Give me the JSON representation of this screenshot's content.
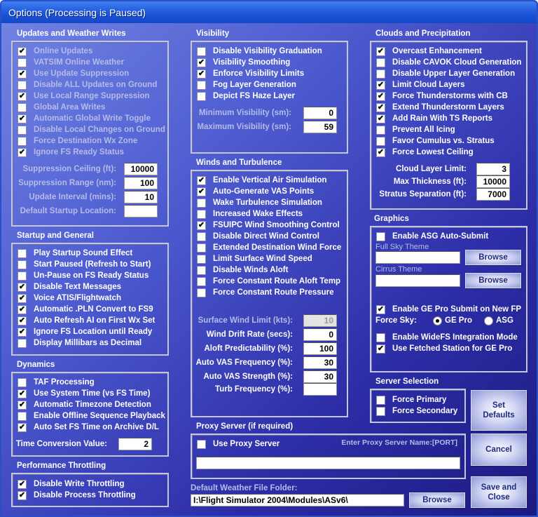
{
  "window": {
    "title": "Options (Processing is Paused)"
  },
  "groups": {
    "updates": {
      "title": "Updates and Weather Writes",
      "disabled": true,
      "items": [
        {
          "label": "Online Updates",
          "checked": true
        },
        {
          "label": "VATSIM Online Weather",
          "checked": false
        },
        {
          "label": "Use Update Suppression",
          "checked": true
        },
        {
          "label": "Disable ALL Updates on Ground",
          "checked": false
        },
        {
          "label": "Use Local Range Suppression",
          "checked": true
        },
        {
          "label": "Global Area Writes",
          "checked": false
        },
        {
          "label": "Automatic Global Write Toggle",
          "checked": true
        },
        {
          "label": "Disable Local Changes on Ground",
          "checked": false
        },
        {
          "label": "Force Destination Wx Zone",
          "checked": false
        },
        {
          "label": "Ignore FS Ready Status",
          "checked": true
        }
      ],
      "fields": [
        {
          "label": "Suppression Ceiling (ft):",
          "value": "10000",
          "disabled": true
        },
        {
          "label": "Suppression Range (nm):",
          "value": "100",
          "disabled": true
        },
        {
          "label": "Update Interval (mins):",
          "value": "10",
          "disabled": true
        },
        {
          "label": "Default Startup Location:",
          "value": "",
          "disabled": true
        }
      ]
    },
    "startup": {
      "title": "Startup and General",
      "items": [
        {
          "label": "Play Startup Sound Effect",
          "checked": false
        },
        {
          "label": "Start Paused (Refresh to Start)",
          "checked": false
        },
        {
          "label": "Un-Pause on FS Ready Status",
          "checked": false
        },
        {
          "label": "Disable Text Messages",
          "checked": true
        },
        {
          "label": "Voice ATIS/Flightwatch",
          "checked": true
        },
        {
          "label": "Automatic .PLN Convert to FS9",
          "checked": true
        },
        {
          "label": "Auto Refresh AI on First Wx Set",
          "checked": true
        },
        {
          "label": "Ignore FS Location until Ready",
          "checked": true
        },
        {
          "label": "Display Millibars as Decimal",
          "checked": false
        }
      ],
      "fields": []
    },
    "dynamics": {
      "title": "Dynamics",
      "items": [
        {
          "label": "TAF Processing",
          "checked": false
        },
        {
          "label": "Use System Time (vs FS Time)",
          "checked": true
        },
        {
          "label": "Automatic Timezone Detection",
          "checked": true
        },
        {
          "label": "Enable Offline Sequence Playback",
          "checked": false
        },
        {
          "label": "Auto Set FS Time on Archive D/L",
          "checked": true
        }
      ],
      "fields": [
        {
          "label": "Time Conversion Value:",
          "value": "2",
          "disabled": false
        }
      ]
    },
    "perf": {
      "title": "Performance Throttling",
      "items": [
        {
          "label": "Disable Write Throttling",
          "checked": true
        },
        {
          "label": "Disable Process Throttling",
          "checked": true
        }
      ],
      "fields": []
    },
    "visibility": {
      "title": "Visibility",
      "items": [
        {
          "label": "Disable Visibility Graduation",
          "checked": false
        },
        {
          "label": "Visibility Smoothing",
          "checked": true
        },
        {
          "label": "Enforce Visibility Limits",
          "checked": true
        },
        {
          "label": "Fog Layer Generation",
          "checked": false
        },
        {
          "label": "Depict FS Haze Layer",
          "checked": false
        }
      ],
      "fields": [
        {
          "label": "Minimum Visibility (sm):",
          "value": "0",
          "disabled": false,
          "labelDisabled": true
        },
        {
          "label": "Maximum Visibility (sm):",
          "value": "59",
          "disabled": false,
          "labelDisabled": true
        }
      ]
    },
    "winds": {
      "title": "Winds and Turbulence",
      "items": [
        {
          "label": "Enable Vertical Air Simulation",
          "checked": true
        },
        {
          "label": "Auto-Generate VAS Points",
          "checked": true
        },
        {
          "label": "Wake Turbulence Simulation",
          "checked": false
        },
        {
          "label": "Increased Wake Effects",
          "checked": false
        },
        {
          "label": "FSUIPC Wind Smoothing Control",
          "checked": true
        },
        {
          "label": "Disable Direct Wind Control",
          "checked": false
        },
        {
          "label": "Extended Destination Wind Force",
          "checked": false
        },
        {
          "label": "Limit Surface Wind Speed",
          "checked": false
        },
        {
          "label": "Disable Winds Aloft",
          "checked": false
        },
        {
          "label": "Force Constant Route Aloft Temp",
          "checked": false
        },
        {
          "label": "Force Constant Route Pressure",
          "checked": false
        }
      ],
      "fields": [
        {
          "label": "Surface Wind Limit (kts):",
          "value": "10",
          "disabled": true
        },
        {
          "label": "Wind Drift Rate (secs):",
          "value": "0",
          "disabled": false
        },
        {
          "label": "Aloft Predictability (%):",
          "value": "100",
          "disabled": false
        },
        {
          "label": "Auto VAS Frequency (%):",
          "value": "30",
          "disabled": false
        },
        {
          "label": "Auto VAS Strength (%):",
          "value": "30",
          "disabled": false
        },
        {
          "label": "Turb Frequency (%):",
          "value": "",
          "disabled": false
        }
      ]
    },
    "clouds": {
      "title": "Clouds and Precipitation",
      "items": [
        {
          "label": "Overcast Enhancement",
          "checked": true
        },
        {
          "label": "Disable CAVOK Cloud Generation",
          "checked": false
        },
        {
          "label": "Disable Upper Layer Generation",
          "checked": false
        },
        {
          "label": "Limit Cloud Layers",
          "checked": true
        },
        {
          "label": "Force Thunderstorms with CB",
          "checked": true
        },
        {
          "label": "Extend Thunderstorm Layers",
          "checked": true
        },
        {
          "label": "Add Rain With TS Reports",
          "checked": true
        },
        {
          "label": "Prevent All Icing",
          "checked": false
        },
        {
          "label": "Favor Cumulus vs. Stratus",
          "checked": false
        },
        {
          "label": "Force Lowest Ceiling",
          "checked": true
        }
      ],
      "fields": [
        {
          "label": "Cloud Layer Limit:",
          "value": "3",
          "disabled": false
        },
        {
          "label": "Max Thickness (ft):",
          "value": "10000",
          "disabled": false
        },
        {
          "label": "Stratus Separation (ft):",
          "value": "7000",
          "disabled": false
        }
      ]
    },
    "server": {
      "title": "Server Selection",
      "items": [
        {
          "label": "Force Primary",
          "checked": false
        },
        {
          "label": "Force Secondary",
          "checked": false
        }
      ],
      "fields": []
    }
  },
  "graphics": {
    "title": "Graphics",
    "asg_label": "Enable ASG Auto-Submit",
    "asg_checked": false,
    "full_sky_label": "Full Sky Theme",
    "full_sky_value": "",
    "cirrus_label": "Cirrus Theme",
    "cirrus_value": "",
    "browse": "Browse",
    "gepro_label": "Enable GE Pro Submit on New FP",
    "gepro_checked": true,
    "force_sky_label": "Force Sky:",
    "radio_gepro": "GE Pro",
    "radio_asg": "ASG",
    "widefs_label": "Enable WideFS Integration Mode",
    "widefs_checked": false,
    "fetched_label": "Use Fetched Station for GE Pro",
    "fetched_checked": true
  },
  "proxy": {
    "title": "Proxy Server (if required)",
    "use_label": "Use Proxy Server",
    "use_checked": false,
    "hint": "Enter Proxy Server Name:[PORT]",
    "value": ""
  },
  "folder": {
    "label": "Default Weather File Folder:",
    "value": "I:\\Flight Simulator 2004\\Modules\\ASv6\\",
    "browse": "Browse"
  },
  "buttons": {
    "set_defaults": "Set Defaults",
    "cancel": "Cancel",
    "save_close": "Save and Close"
  }
}
